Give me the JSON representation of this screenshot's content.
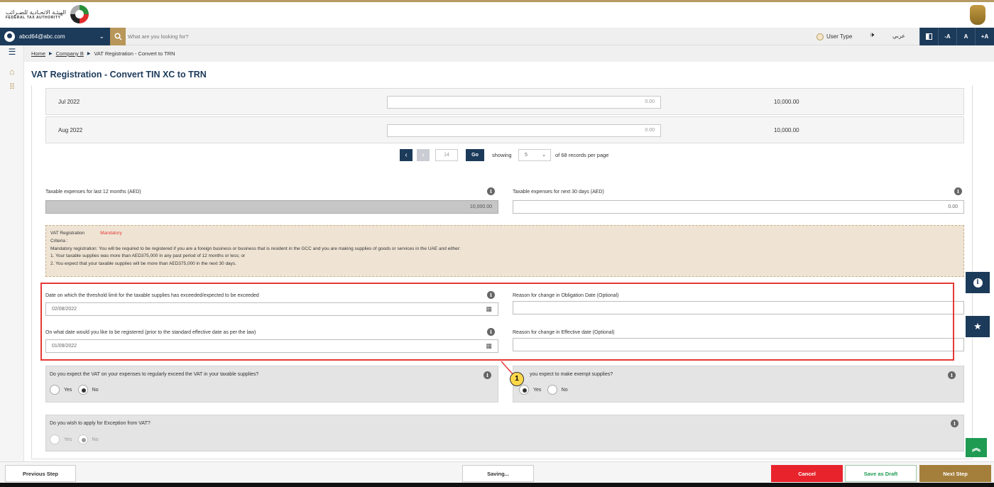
{
  "header": {
    "logo_ar": "الهيئـة الاتحـادية للضـرائب",
    "logo_en": "FEDERAL TAX AUTHORITY"
  },
  "topbar": {
    "user_email": "abcd64@abc.com",
    "search_placeholder": "What are you looking for?",
    "user_type": "User Type",
    "language": "عربي",
    "font_decrease": "-A",
    "font_normal": "A",
    "font_increase": "+A"
  },
  "breadcrumb": {
    "items": [
      "Home",
      "Company B",
      "VAT Registration - Convert to TRN"
    ]
  },
  "page": {
    "title": "VAT Registration - Convert TIN XC to TRN"
  },
  "table": {
    "rows": [
      {
        "month": "Jul 2022",
        "value": "0.00",
        "total": "10,000.00"
      },
      {
        "month": "Aug 2022",
        "value": "0.00",
        "total": "10,000.00"
      }
    ]
  },
  "pagination": {
    "page_number": "14",
    "go_label": "Go",
    "showing_label": "showing",
    "page_size": "5",
    "records_text": "of 68 records per page"
  },
  "expenses": {
    "last12_label": "Taxable expenses for last 12 months (AED)",
    "last12_value": "10,000.00",
    "next30_label": "Taxable expenses for next 30 days (AED)",
    "next30_value": "0.00"
  },
  "criteria": {
    "title": "VAT Registration",
    "status": "Mandatory",
    "criteria_label": "Criteria :",
    "line1": "Mandatory registration: You will be required to be registered if you are a foreign business or business that is resident in the GCC and you are making supplies of goods or services in the UAE and either:",
    "line2": "1. Your taxable supplies was more than AED375,000 in any past period of 12 months or less; or",
    "line3": "2. You expect that your taxable supplies will be more than AED375,000 in the next 30 days."
  },
  "dates": {
    "threshold_label": "Date on which the threshold limit for the taxable supplies has exceeded/expected to be exceeded",
    "threshold_value": "02/08/2022",
    "obligation_reason_label": "Reason for change in Obligation Date (Optional)",
    "register_label": "On what date would you like to be registered (prior to the standard effective date as per the law)",
    "register_value": "01/09/2022",
    "effective_reason_label": "Reason for change in Effective date (Optional)"
  },
  "questions": {
    "q1": "Do you expect the VAT on your expenses to regularly exceed the VAT in your taxable supplies?",
    "q2": "you expect to make exempt supplies?",
    "q3": "Do you wish to apply for Exception from VAT?",
    "yes": "Yes",
    "no": "No",
    "q1_selected": "No",
    "q2_selected": "Yes",
    "q3_selected": "No"
  },
  "callout": "1",
  "footer": {
    "previous": "Previous Step",
    "status": "Saving...",
    "cancel": "Cancel",
    "save_draft": "Save as Draft",
    "next": "Next Step"
  },
  "colors": {
    "navy": "#1c3a5a",
    "gold": "#b8975a",
    "red": "#e53935",
    "green": "#1f9b52"
  }
}
